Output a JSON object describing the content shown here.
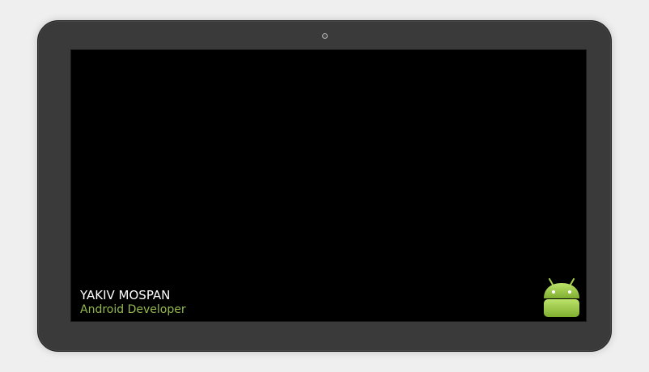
{
  "profile": {
    "name": "YAKIV MOSPAN",
    "role": "Android Developer"
  },
  "icons": {
    "camera": "camera-lens-icon",
    "logo": "android-robot-icon"
  },
  "colors": {
    "background": "#efefef",
    "bezel": "#3a3a3a",
    "screen": "#000000",
    "name_text": "#ffffff",
    "role_text": "#95b94f",
    "android_green": "#97c639"
  }
}
